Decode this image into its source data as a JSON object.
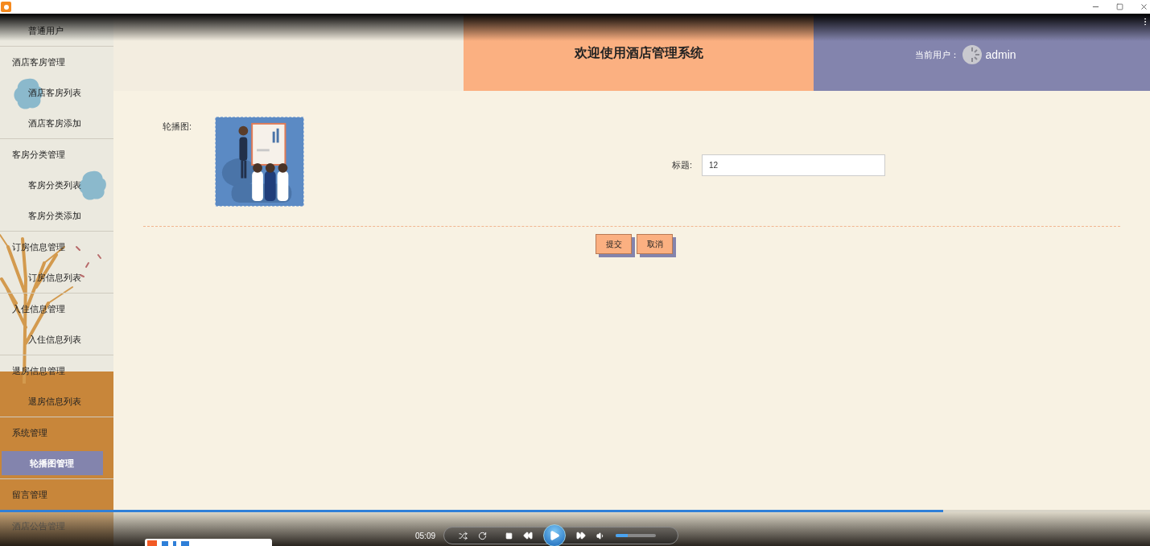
{
  "sidebar": {
    "items": [
      {
        "kind": "link",
        "label": "普通用户",
        "selected": false
      },
      {
        "kind": "header",
        "label": "酒店客房管理"
      },
      {
        "kind": "link",
        "label": "酒店客房列表",
        "selected": false
      },
      {
        "kind": "link",
        "label": "酒店客房添加",
        "selected": false
      },
      {
        "kind": "header",
        "label": "客房分类管理"
      },
      {
        "kind": "link",
        "label": "客房分类列表",
        "selected": false
      },
      {
        "kind": "link",
        "label": "客房分类添加",
        "selected": false
      },
      {
        "kind": "header",
        "label": "订房信息管理"
      },
      {
        "kind": "link",
        "label": "订房信息列表",
        "selected": false
      },
      {
        "kind": "header",
        "label": "入住信息管理"
      },
      {
        "kind": "link",
        "label": "入住信息列表",
        "selected": false
      },
      {
        "kind": "header",
        "label": "退房信息管理"
      },
      {
        "kind": "link",
        "label": "退房信息列表",
        "selected": false
      },
      {
        "kind": "header",
        "label": "系统管理"
      },
      {
        "kind": "link",
        "label": "轮播图管理",
        "selected": true
      },
      {
        "kind": "header",
        "label": "留言管理"
      },
      {
        "kind": "header",
        "label": "酒店公告管理"
      }
    ]
  },
  "header": {
    "title": "欢迎使用酒店管理系统",
    "user_label": "当前用户：",
    "user_name": "admin"
  },
  "form": {
    "image_label": "轮播图:",
    "title_label": "标题:",
    "title_value": "12",
    "buttons": [
      "提交",
      "取消"
    ]
  },
  "player": {
    "time": "05:09",
    "seek": {
      "level": 0.82
    },
    "volume": {
      "level": 0.3
    }
  }
}
